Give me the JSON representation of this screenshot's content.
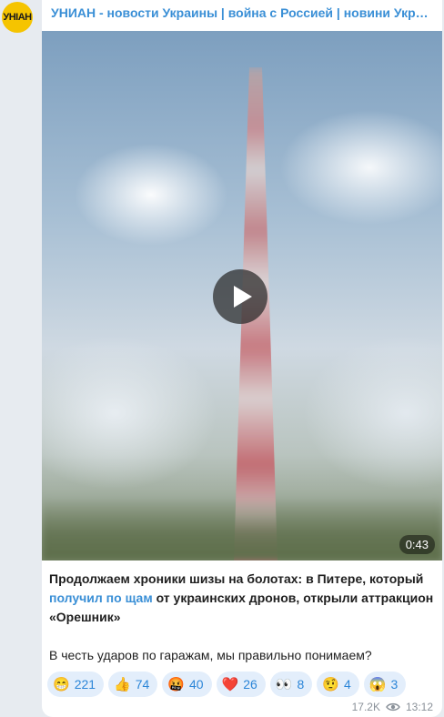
{
  "channel": {
    "avatar_text": "УНІАН",
    "name": "УНИАН - новости Украины | война с Россией | новини України | Ukraine"
  },
  "video": {
    "duration": "0:43"
  },
  "message": {
    "text_part1": "Продолжаем хроники шизы на болотах: в Питере, который ",
    "link_text": "получил по щам",
    "text_part2": " от украинских дронов, открыли аттракцион «Орешник»",
    "text_line2": "В честь ударов по гаражам, мы правильно понимаем?"
  },
  "reactions": [
    {
      "emoji": "😁",
      "count": "221"
    },
    {
      "emoji": "👍",
      "count": "74"
    },
    {
      "emoji": "🤬",
      "count": "40"
    },
    {
      "emoji": "❤️",
      "count": "26"
    },
    {
      "emoji": "👀",
      "count": "8"
    },
    {
      "emoji": "🤨",
      "count": "4"
    },
    {
      "emoji": "😱",
      "count": "3"
    }
  ],
  "meta": {
    "views": "17.2K",
    "time": "13:12"
  },
  "colors": {
    "link": "#3a8fd6",
    "reaction_bg": "#e3eefb",
    "avatar_bg": "#f5c400"
  }
}
